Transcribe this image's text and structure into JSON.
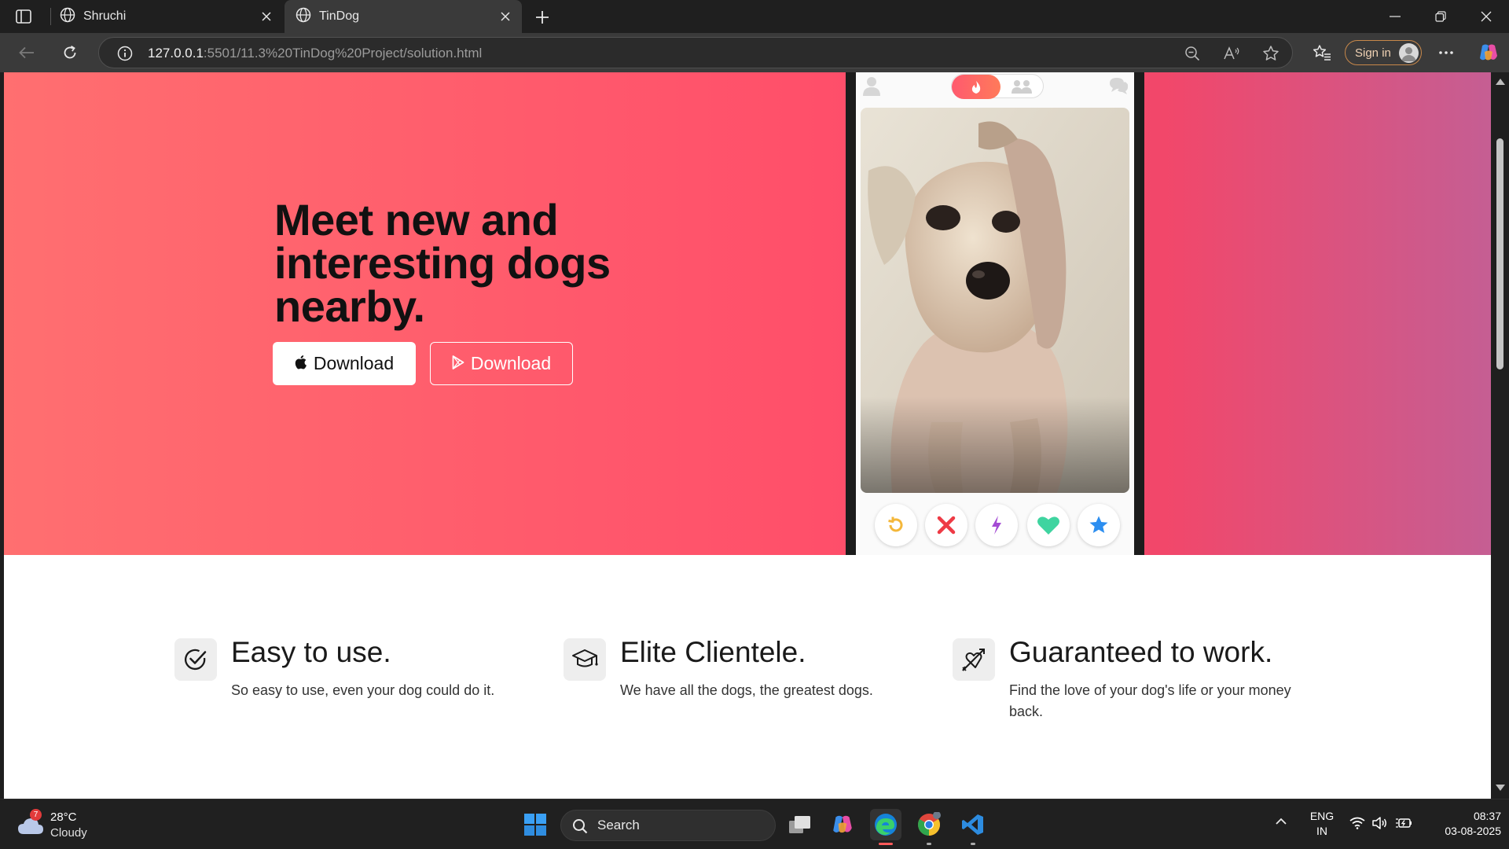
{
  "browser": {
    "tabs": [
      {
        "title": "Shruchi",
        "icon": "globe-icon",
        "active": false
      },
      {
        "title": "TinDog",
        "icon": "globe-icon",
        "active": true
      }
    ],
    "address": {
      "host": "127.0.0.1",
      "path": ":5501/11.3%20TinDog%20Project/solution.html"
    },
    "signin_label": "Sign in"
  },
  "hero": {
    "title": "Meet new and interesting dogs nearby.",
    "buttons": [
      {
        "label": "Download",
        "icon": "apple-icon",
        "style": "dark"
      },
      {
        "label": "Download",
        "icon": "google-play-icon",
        "style": "outline"
      }
    ]
  },
  "features": [
    {
      "icon": "check-circle-icon",
      "title": "Easy to use.",
      "text": "So easy to use, even your dog could do it."
    },
    {
      "icon": "graduation-cap-icon",
      "title": "Elite Clientele.",
      "text": "We have all the dogs, the greatest dogs."
    },
    {
      "icon": "heart-arrow-icon",
      "title": "Guaranteed to work.",
      "text": "Find the love of your dog's life or your money back."
    }
  ],
  "taskbar": {
    "weather": {
      "temp": "28°C",
      "desc": "Cloudy",
      "badge": "7"
    },
    "search_label": "Search",
    "lang": {
      "line1": "ENG",
      "line2": "IN"
    },
    "clock": {
      "time": "08:37",
      "date": "03-08-2025"
    }
  },
  "colors": {
    "hero_start": "#ff6f70",
    "hero_mid": "#ff4f6a",
    "hero_end": "#c55e93"
  }
}
